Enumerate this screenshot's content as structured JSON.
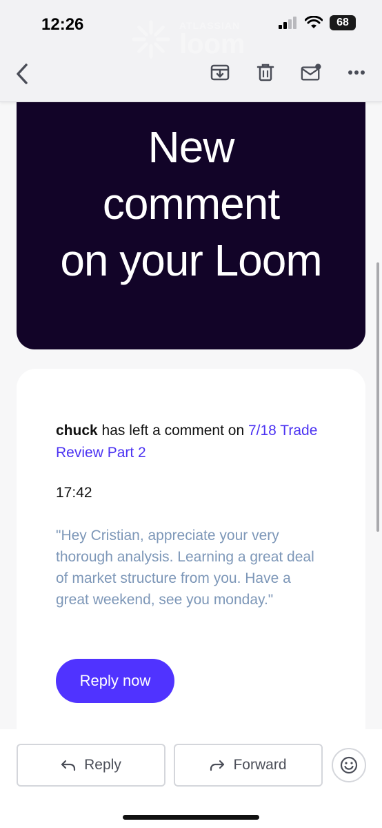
{
  "status_bar": {
    "time": "12:26",
    "battery": "68"
  },
  "header": {
    "brand_top": "ATLASSIAN",
    "brand": "loom"
  },
  "toolbar": {
    "back_icon": "chevron-left-icon",
    "actions": [
      "archive-icon",
      "trash-icon",
      "mail-unread-icon",
      "more-icon"
    ]
  },
  "hero": {
    "line1": "New",
    "line2": "comment",
    "line3": "on your Loom"
  },
  "comment": {
    "author": "chuck",
    "intro_text": " has left a comment on ",
    "video_title": "7/18 Trade Review Part 2",
    "timestamp": "17:42",
    "quote": "\"Hey Cristian, appreciate your very thorough analysis. Learning a great deal of market structure from you. Have a great weekend, see you monday.\"",
    "reply_label": "Reply now"
  },
  "bottom_actions": {
    "reply_label": "Reply",
    "forward_label": "Forward"
  },
  "colors": {
    "hero_bg": "#120428",
    "accent": "#5033ff",
    "link": "#4b32f2",
    "quote_text": "#7d97b8"
  }
}
